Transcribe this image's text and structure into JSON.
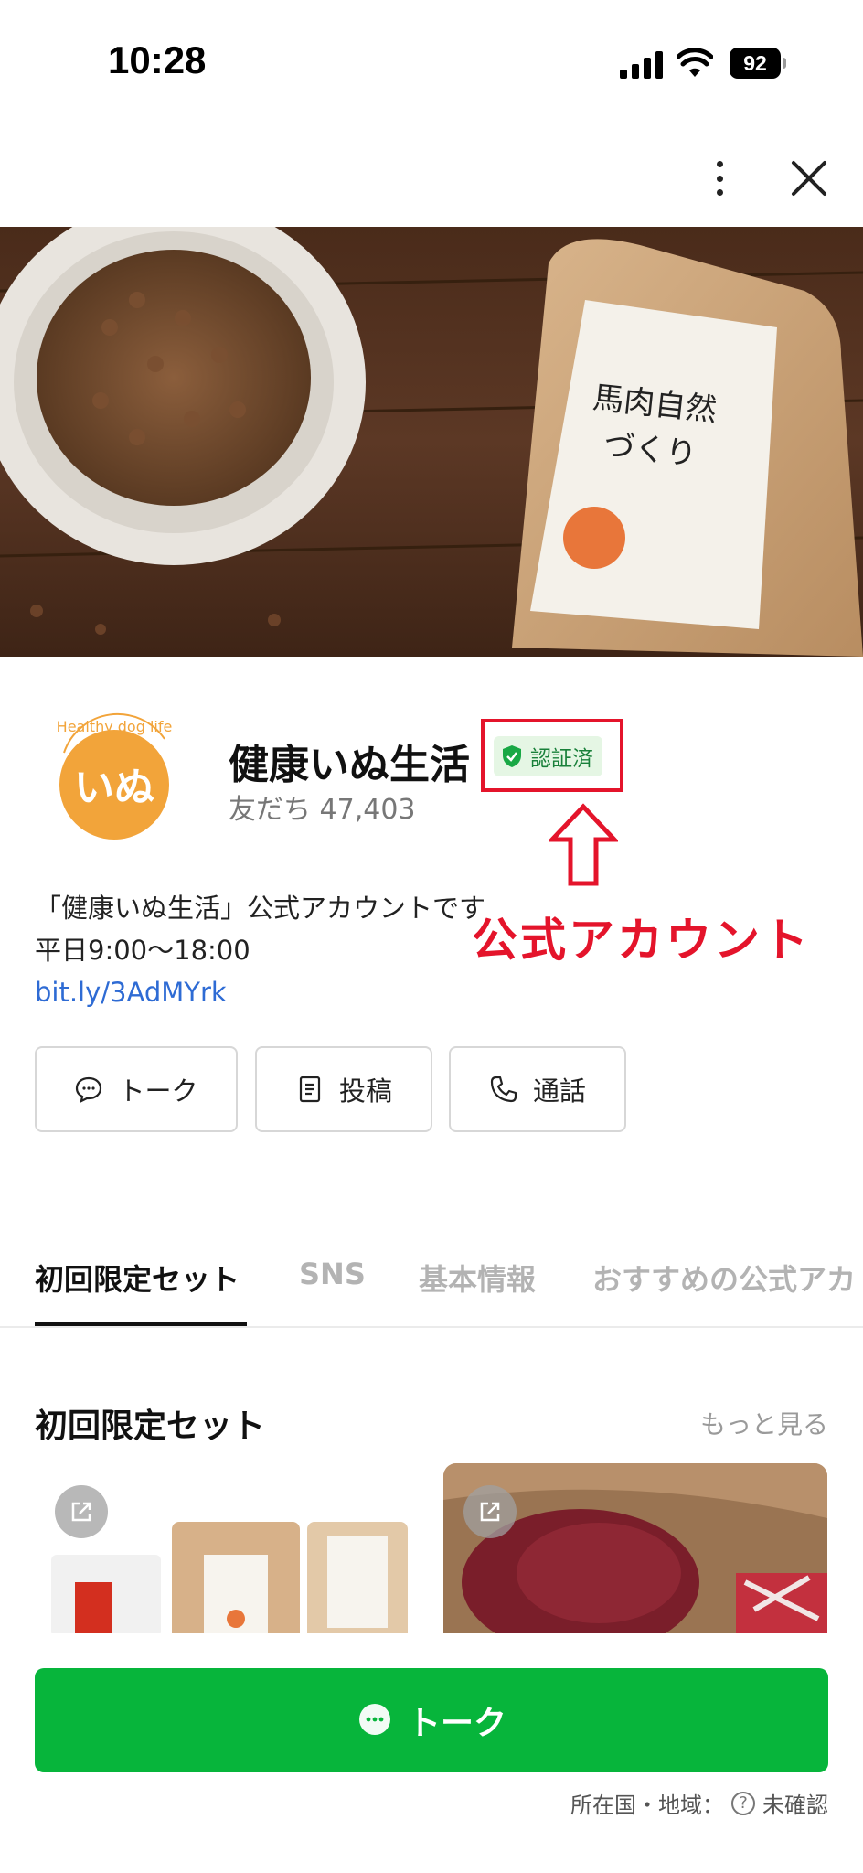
{
  "status_bar": {
    "time": "10:28",
    "battery": "92"
  },
  "account": {
    "name": "健康いぬ生活",
    "verified_label": "認証済",
    "friends": "友だち 47,403",
    "description": "「健康いぬ生活」公式アカウントです",
    "hours": "平日9:00〜18:00",
    "link": "bit.ly/3AdMYrk",
    "logo_arc_text": "Healthy dog life",
    "logo_text": "いぬ"
  },
  "hero": {
    "package_title_1": "馬肉自然",
    "package_title_2": "づくり"
  },
  "annotation": "公式アカウント",
  "actions": [
    {
      "label": "トーク",
      "icon": "chat-bubble-icon"
    },
    {
      "label": "投稿",
      "icon": "document-icon"
    },
    {
      "label": "通話",
      "icon": "phone-icon"
    }
  ],
  "tabs": [
    "初回限定セット",
    "SNS",
    "基本情報",
    "おすすめの公式アカ"
  ],
  "section": {
    "title": "初回限定セット",
    "more": "もっと見る"
  },
  "bottom": {
    "talk_label": "トーク",
    "location": "所在国・地域：",
    "location_status": "未確認"
  },
  "colors": {
    "line_green": "#07b53b",
    "annotation_red": "#e4142b",
    "link_blue": "#2e6bd4"
  }
}
